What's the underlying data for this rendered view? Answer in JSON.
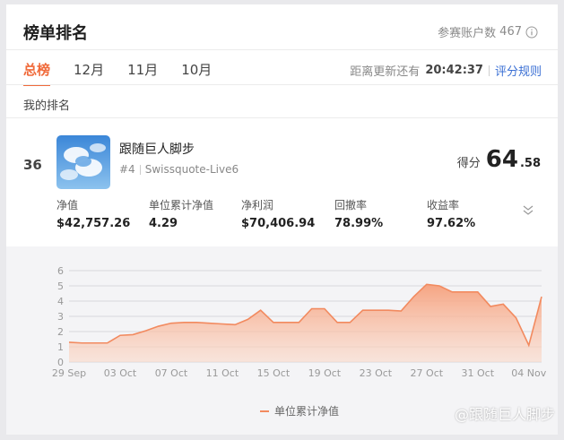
{
  "header": {
    "title": "榜单排名",
    "participants_label": "参赛账户数",
    "participants_count": "467"
  },
  "tabs": [
    {
      "label": "总榜",
      "active": true
    },
    {
      "label": "12月",
      "active": false
    },
    {
      "label": "11月",
      "active": false
    },
    {
      "label": "10月",
      "active": false
    }
  ],
  "countdown": {
    "label": "距离更新还有",
    "time": "20:42:37",
    "rules_link": "评分规则"
  },
  "my_rank_label": "我的排名",
  "trader": {
    "rank": "36",
    "name": "跟随巨人脚步",
    "badge": "#4",
    "account": "Swissquote-Live6",
    "score_label": "得分",
    "score_int": "64",
    "score_dec": ".58"
  },
  "stats": [
    {
      "label": "净值",
      "value": "$42,757.26"
    },
    {
      "label": "单位累计净值",
      "value": "4.29"
    },
    {
      "label": "净利润",
      "value": "$70,406.94"
    },
    {
      "label": "回撤率",
      "value": "78.99%"
    },
    {
      "label": "收益率",
      "value": "97.62%"
    }
  ],
  "colors": {
    "accent": "#f06a3a",
    "line": "#f28a5f",
    "link": "#3a6fd4"
  },
  "chart_data": {
    "type": "area",
    "x": [
      "29 Sep",
      "30 Sep",
      "01 Oct",
      "02 Oct",
      "03 Oct",
      "04 Oct",
      "05 Oct",
      "06 Oct",
      "07 Oct",
      "08 Oct",
      "09 Oct",
      "10 Oct",
      "11 Oct",
      "12 Oct",
      "13 Oct",
      "14 Oct",
      "15 Oct",
      "16 Oct",
      "17 Oct",
      "18 Oct",
      "19 Oct",
      "20 Oct",
      "21 Oct",
      "22 Oct",
      "23 Oct",
      "24 Oct",
      "25 Oct",
      "26 Oct",
      "27 Oct",
      "28 Oct",
      "29 Oct",
      "30 Oct",
      "31 Oct",
      "01 Nov",
      "02 Nov",
      "03 Nov",
      "04 Nov"
    ],
    "values": [
      1.3,
      1.25,
      1.25,
      1.25,
      1.75,
      1.8,
      2.05,
      2.35,
      2.55,
      2.6,
      2.6,
      2.55,
      2.5,
      2.45,
      2.8,
      3.4,
      2.6,
      2.6,
      2.6,
      3.5,
      3.5,
      2.6,
      2.6,
      3.4,
      3.4,
      3.4,
      3.35,
      4.3,
      5.1,
      5.0,
      4.6,
      4.6,
      4.6,
      3.65,
      3.8,
      2.9,
      1.1,
      4.29
    ],
    "x_ticks": [
      "29 Sep",
      "03 Oct",
      "07 Oct",
      "11 Oct",
      "15 Oct",
      "19 Oct",
      "23 Oct",
      "27 Oct",
      "31 Oct",
      "04 Nov"
    ],
    "y_ticks": [
      "0",
      "1",
      "2",
      "3",
      "4",
      "5",
      "6"
    ],
    "ylim": [
      0,
      6
    ],
    "grid": true,
    "series": [
      {
        "name": "单位累计净值"
      }
    ],
    "legend_position": "bottom-center"
  },
  "watermark": "@跟随巨人脚步"
}
